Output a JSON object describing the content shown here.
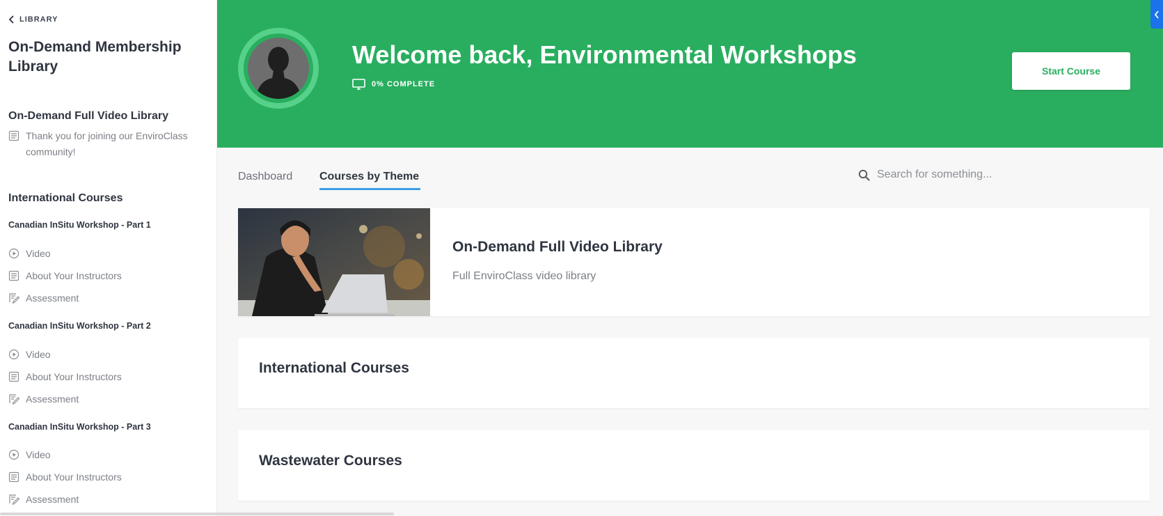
{
  "sidebar": {
    "back_label": "LIBRARY",
    "title": "On-Demand Membership Library",
    "sections": [
      {
        "title": "On-Demand Full Video Library",
        "items": [
          {
            "icon": "document-icon",
            "label": "Thank you for joining our EnviroClass community!"
          }
        ]
      },
      {
        "title": "International Courses",
        "groups": [
          {
            "title": "Canadian InSitu Workshop - Part 1",
            "items": [
              {
                "icon": "play-circle-icon",
                "label": "Video"
              },
              {
                "icon": "document-icon",
                "label": "About Your Instructors"
              },
              {
                "icon": "quiz-icon",
                "label": "Assessment"
              }
            ]
          },
          {
            "title": "Canadian InSitu Workshop - Part 2",
            "items": [
              {
                "icon": "play-circle-icon",
                "label": "Video"
              },
              {
                "icon": "document-icon",
                "label": "About Your Instructors"
              },
              {
                "icon": "quiz-icon",
                "label": "Assessment"
              }
            ]
          },
          {
            "title": "Canadian InSitu Workshop - Part 3",
            "items": [
              {
                "icon": "play-circle-icon",
                "label": "Video"
              },
              {
                "icon": "document-icon",
                "label": "About Your Instructors"
              },
              {
                "icon": "quiz-icon",
                "label": "Assessment"
              }
            ]
          }
        ]
      }
    ]
  },
  "hero": {
    "welcome": "Welcome back, Environmental Workshops",
    "progress_label": "0% COMPLETE",
    "progress_percent": 0,
    "start_button": "Start Course",
    "background_color": "#29ae5f"
  },
  "tabs": [
    {
      "label": "Dashboard",
      "active": false
    },
    {
      "label": "Courses by Theme",
      "active": true
    }
  ],
  "search": {
    "placeholder": "Search for something..."
  },
  "cards": [
    {
      "title": "On-Demand Full Video Library",
      "description": "Full EnviroClass video library"
    },
    {
      "title": "International Courses"
    },
    {
      "title": "Wastewater Courses"
    }
  ]
}
